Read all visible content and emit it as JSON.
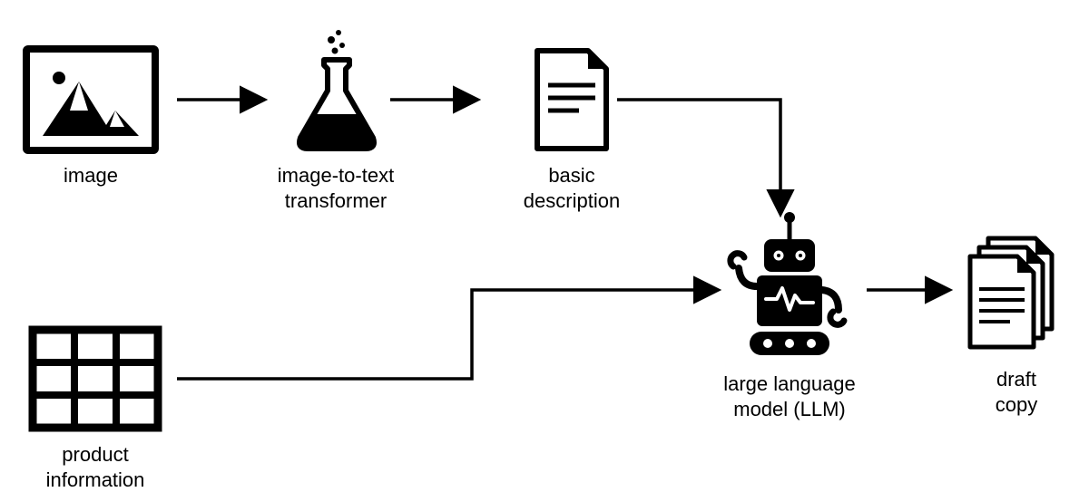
{
  "nodes": {
    "image": {
      "label": "image"
    },
    "transformer": {
      "label_line1": "image-to-text",
      "label_line2": "transformer"
    },
    "description": {
      "label_line1": "basic",
      "label_line2": "description"
    },
    "product": {
      "label_line1": "product",
      "label_line2": "information"
    },
    "llm": {
      "label_line1": "large language",
      "label_line2": "model (LLM)"
    },
    "draft": {
      "label_line1": "draft",
      "label_line2": "copy"
    }
  }
}
